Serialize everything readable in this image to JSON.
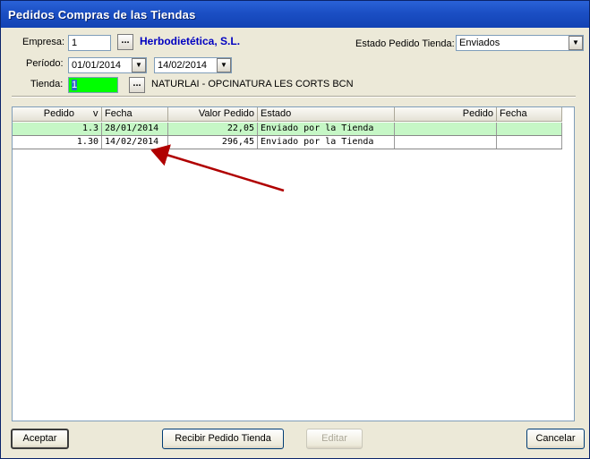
{
  "window": {
    "title": "Pedidos Compras de las Tiendas"
  },
  "form": {
    "empresa_label": "Empresa:",
    "empresa_value": "1",
    "empresa_name": "Herbodietética, S.L.",
    "periodo_label": "Período:",
    "periodo_from": "01/01/2014",
    "periodo_to": "14/02/2014",
    "tienda_label": "Tienda:",
    "tienda_value": "1",
    "tienda_name": "NATURLAI - OPCINATURA LES CORTS BCN",
    "estado_label": "Estado Pedido Tienda:",
    "estado_value": "Enviados",
    "lookup_label": "..."
  },
  "grid": {
    "columns": [
      "Pedido",
      "v",
      "Fecha",
      "Valor Pedido",
      "Estado",
      "Pedido",
      "Fecha"
    ],
    "rows": [
      {
        "pedido": "1.3",
        "fecha": "28/01/2014",
        "valor": "22,05",
        "estado": "Enviado por la Tienda"
      },
      {
        "pedido": "1.30",
        "fecha": "14/02/2014",
        "valor": "296,45",
        "estado": "Enviado por la Tienda"
      }
    ]
  },
  "buttons": {
    "aceptar": "Aceptar",
    "recibir": "Recibir Pedido Tienda",
    "editar": "Editar",
    "cancelar": "Cancelar"
  },
  "colors": {
    "title_bar": "#1b4fc4",
    "empresa_name": "#0000c0",
    "tienda_highlight": "#00ff00",
    "selected_row": "#c6f7c6",
    "annotation_arrow": "#b00000"
  }
}
